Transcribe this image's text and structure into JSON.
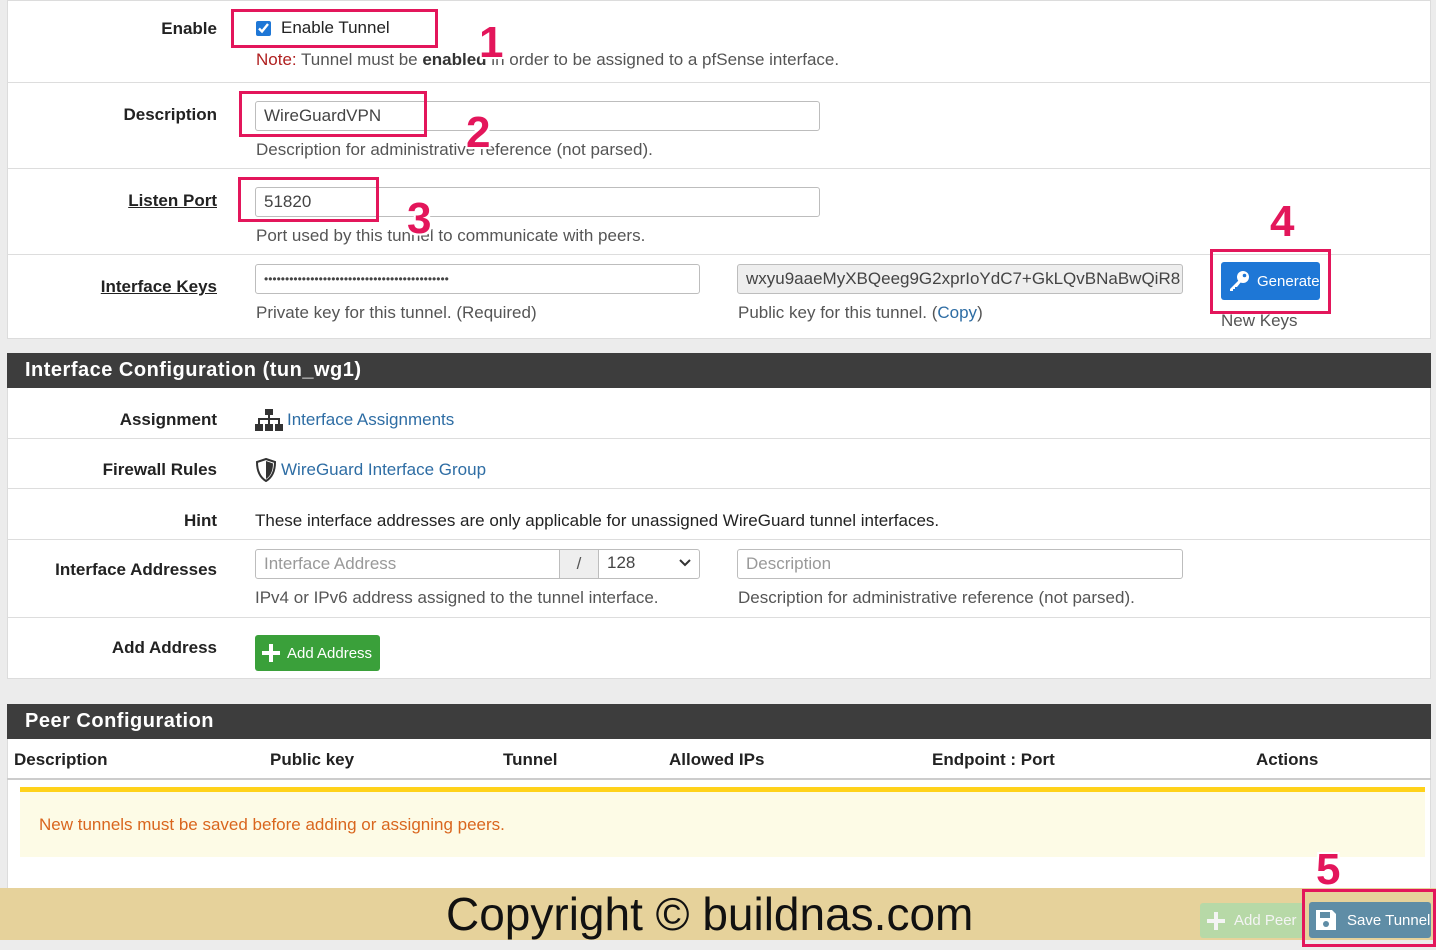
{
  "tunnel": {
    "enable": {
      "label": "Enable",
      "checkbox_label": "Enable Tunnel",
      "checked": true,
      "note_prefix": "Note:",
      "note_pre": " Tunnel must be ",
      "note_bold": "enabled",
      "note_post": " in order to be assigned to a pfSense interface."
    },
    "description": {
      "label": "Description",
      "value": "WireGuardVPN",
      "help": "Description for administrative reference (not parsed)."
    },
    "listen_port": {
      "label": "Listen Port",
      "value": "51820",
      "help": "Port used by this tunnel to communicate with peers."
    },
    "interface_keys": {
      "label": "Interface Keys",
      "private_value": "••••••••••••••••••••••••••••••••••••••••••••",
      "private_help": "Private key for this tunnel. (Required)",
      "public_value": "wxyu9aaeMyXBQeeg9G2xprIoYdC7+GkLQvBNaBwQiR8",
      "public_help_pre": "Public key for this tunnel. (",
      "public_help_link": "Copy",
      "public_help_post": ")",
      "generate_label": "Generate",
      "generate_help": "New Keys"
    }
  },
  "interface_config": {
    "title": "Interface Configuration (tun_wg1)",
    "assignment": {
      "label": "Assignment",
      "link": "Interface Assignments"
    },
    "firewall_rules": {
      "label": "Firewall Rules",
      "link": "WireGuard Interface Group"
    },
    "hint": {
      "label": "Hint",
      "text": "These interface addresses are only applicable for unassigned WireGuard tunnel interfaces."
    },
    "addresses": {
      "label": "Interface Addresses",
      "address_placeholder": "Interface Address",
      "slash": "/",
      "cidr_value": "128",
      "description_placeholder": "Description",
      "address_help": "IPv4 or IPv6 address assigned to the tunnel interface.",
      "description_help": "Description for administrative reference (not parsed)."
    },
    "add_address": {
      "label": "Add Address",
      "button": "Add Address"
    }
  },
  "peer_config": {
    "title": "Peer Configuration",
    "columns": [
      "Description",
      "Public key",
      "Tunnel",
      "Allowed IPs",
      "Endpoint : Port",
      "Actions"
    ],
    "warning": "New tunnels must be saved before adding or assigning peers."
  },
  "footer": {
    "copyright": "Copyright © buildnas.com",
    "add_peer": "Add Peer",
    "save_tunnel": "Save Tunnel"
  },
  "annotations": [
    "1",
    "2",
    "3",
    "4",
    "5"
  ],
  "colors": {
    "annotation": "#e3165b",
    "section_header": "#3d3d3d",
    "link": "#2e6da4",
    "primary_button": "#1e77d6",
    "success_button": "#3aa03a",
    "warning_text": "#d9661e",
    "warning_bg": "#fdfbe6",
    "warning_border": "#ffd21a"
  }
}
